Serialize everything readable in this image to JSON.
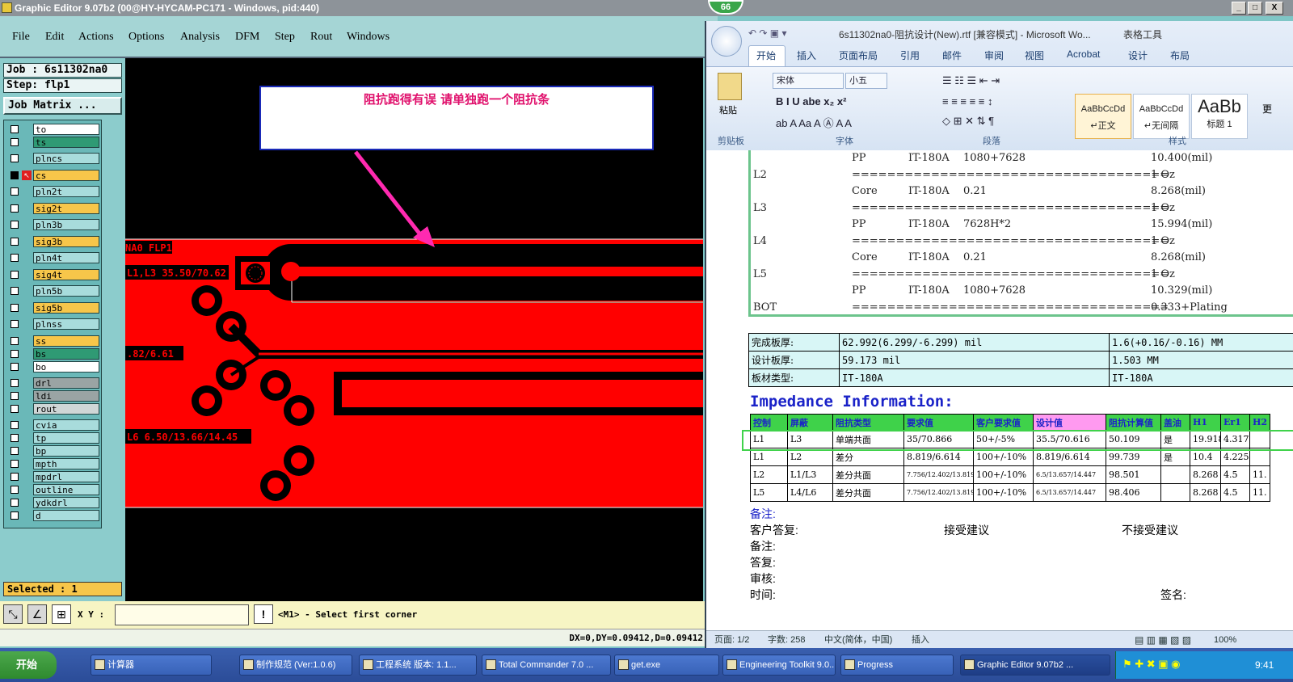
{
  "ge": {
    "title": "Graphic Editor 9.07b2 (00@HY-HYCAM-PC171 - Windows, pid:440)",
    "window_buttons": [
      "_",
      "□",
      "X"
    ],
    "menu": [
      "File",
      "Edit",
      "Actions",
      "Options",
      "Analysis",
      "DFM",
      "Step",
      "Rout",
      "Windows"
    ],
    "job": "Job : 6s11302na0",
    "step": "Step: flp1",
    "job_matrix": "Job Matrix ...",
    "layers": [
      {
        "name": "to",
        "color": "#ffffff"
      },
      {
        "name": "ts",
        "color": "#2f9a74"
      },
      {
        "name": "plncs",
        "color": "#a8dcdc"
      },
      {
        "name": "cs",
        "color": "#f7c64a"
      },
      {
        "name": "pln2t",
        "color": "#a8dcdc"
      },
      {
        "name": "sig2t",
        "color": "#f7c64a"
      },
      {
        "name": "pln3b",
        "color": "#a8dcdc"
      },
      {
        "name": "sig3b",
        "color": "#f7c64a"
      },
      {
        "name": "pln4t",
        "color": "#a8dcdc"
      },
      {
        "name": "sig4t",
        "color": "#f7c64a"
      },
      {
        "name": "pln5b",
        "color": "#a8dcdc"
      },
      {
        "name": "sig5b",
        "color": "#f7c64a"
      },
      {
        "name": "plnss",
        "color": "#a8dcdc"
      },
      {
        "name": "ss",
        "color": "#f7c64a"
      },
      {
        "name": "bs",
        "color": "#2f9a74"
      },
      {
        "name": "bo",
        "color": "#ffffff"
      },
      {
        "name": "drl",
        "color": "#9aa4a4"
      },
      {
        "name": "ldi",
        "color": "#9aa4a4"
      },
      {
        "name": "rout",
        "color": "#cfd6d6"
      },
      {
        "name": "cvia",
        "color": "#a8dcdc"
      },
      {
        "name": "tp",
        "color": "#a8dcdc"
      },
      {
        "name": "bp",
        "color": "#a8dcdc"
      },
      {
        "name": "mpth",
        "color": "#a8dcdc"
      },
      {
        "name": "mpdrl",
        "color": "#a8dcdc"
      },
      {
        "name": "outline",
        "color": "#a8dcdc"
      },
      {
        "name": "ydkdrl",
        "color": "#a8dcdc"
      },
      {
        "name": "d",
        "color": "#a8dcdc"
      }
    ],
    "selected": "Selected : 1",
    "annotation": "阻抗跑得有误   请单独跑一个阻抗条",
    "pcb_labels": [
      "NA0 FLP1",
      "L1,L3 35.50/70.62",
      ".82/6.61",
      "L6 6.50/13.66/14.45"
    ],
    "xy_label": "X Y :",
    "xy_value": "",
    "prompt": "<M1> - Select first corner",
    "status": "DX=0,DY=0.09412,D=0.09412"
  },
  "badge": "66",
  "word": {
    "title": "6s11302na0-阻抗设计(New).rtf [兼容模式] - Microsoft Wo...",
    "context_tab": "表格工具",
    "tabs": [
      "开始",
      "插入",
      "页面布局",
      "引用",
      "邮件",
      "审阅",
      "视图",
      "Acrobat",
      "设计",
      "布局"
    ],
    "font_name": "宋体",
    "font_size": "小五",
    "groups": [
      "剪贴板",
      "字体",
      "段落",
      "样式"
    ],
    "paste_label": "粘贴",
    "styles": [
      {
        "preview": "AaBbCcDd",
        "name": "↵正文"
      },
      {
        "preview": "AaBbCcDd",
        "name": "↵无间隔"
      },
      {
        "preview": "AaBb",
        "name": "标题 1"
      }
    ],
    "change_styles": "更",
    "stackup": [
      {
        "layer": "",
        "type": "PP",
        "mat": "IT-180A",
        "spec": "1080+7628",
        "val": "10.400(mil)"
      },
      {
        "layer": "L2",
        "type": "",
        "mat": "",
        "spec": "====================================",
        "val": "1 Oz"
      },
      {
        "layer": "",
        "type": "Core",
        "mat": "IT-180A",
        "spec": "0.21",
        "val": "8.268(mil)"
      },
      {
        "layer": "L3",
        "type": "",
        "mat": "",
        "spec": "====================================",
        "val": "1 Oz"
      },
      {
        "layer": "",
        "type": "PP",
        "mat": "IT-180A",
        "spec": "7628H*2",
        "val": "15.994(mil)"
      },
      {
        "layer": "L4",
        "type": "",
        "mat": "",
        "spec": "====================================",
        "val": "1 Oz"
      },
      {
        "layer": "",
        "type": "Core",
        "mat": "IT-180A",
        "spec": "0.21",
        "val": "8.268(mil)"
      },
      {
        "layer": "L5",
        "type": "",
        "mat": "",
        "spec": "====================================",
        "val": "1 Oz"
      },
      {
        "layer": "",
        "type": "PP",
        "mat": "IT-180A",
        "spec": "1080+7628",
        "val": "10.329(mil)"
      },
      {
        "layer": "BOT",
        "type": "",
        "mat": "",
        "spec": "====================================",
        "val": "0.333+Plating"
      }
    ],
    "board": [
      [
        "完成板厚:",
        "62.992(6.299/-6.299) mil",
        "1.6(+0.16/-0.16) MM"
      ],
      [
        "设计板厚:",
        "59.173 mil",
        "1.503 MM"
      ],
      [
        "板材类型:",
        "IT-180A",
        "IT-180A"
      ]
    ],
    "imp_title": "Impedance Information:",
    "imp_headers": [
      "控制",
      "屏蔽",
      "阻抗类型",
      "要求值",
      "客户要求值",
      "设计值",
      "阻抗计算值",
      "盖油",
      "H1",
      "Er1",
      "H2"
    ],
    "imp_rows": [
      [
        "L1",
        "L3",
        "单端共面",
        "35/70.866",
        "50+/-5%",
        "35.5/70.616",
        "50.109",
        "是",
        "19.918",
        "4.317",
        ""
      ],
      [
        "L1",
        "L2",
        "差分",
        "8.819/6.614",
        "100+/-10%",
        "8.819/6.614",
        "99.739",
        "是",
        "10.4",
        "4.225",
        ""
      ],
      [
        "L2",
        "L1/L3",
        "差分共面",
        "7.756/12.402/13.819",
        "100+/-10%",
        "6.5/13.657/14.447",
        "98.501",
        "",
        "8.268",
        "4.5",
        "11."
      ],
      [
        "L5",
        "L4/L6",
        "差分共面",
        "7.756/12.402/13.819",
        "100+/-10%",
        "6.5/13.657/14.447",
        "98.406",
        "",
        "8.268",
        "4.5",
        "11."
      ]
    ],
    "notes": [
      "备注:",
      "客户答复:",
      "备注:",
      "答复:",
      "审核:",
      "时间:"
    ],
    "accept": "接受建议",
    "reject": "不接受建议",
    "sign": "签名:",
    "status": {
      "page": "页面: 1/2",
      "words": "字数: 258",
      "lang": "中文(简体，中国)",
      "mode": "插入",
      "zoom": "100%"
    }
  },
  "taskbar": {
    "start": "开始",
    "items": [
      "计算器",
      "制作规范 (Ver:1.0.6)",
      "工程系统  版本: 1.1...",
      "Total Commander 7.0 ...",
      "get.exe",
      "Engineering Toolkit 9.0...",
      "Progress",
      "Graphic Editor 9.07b2 ..."
    ],
    "clock": "9:41"
  }
}
